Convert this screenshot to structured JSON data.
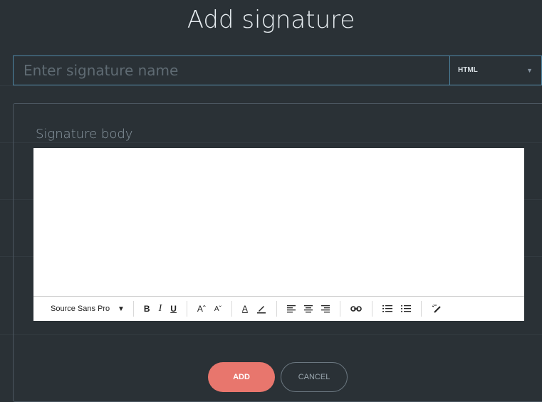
{
  "modal": {
    "title": "Add signature",
    "name_placeholder": "Enter signature name",
    "type_select": {
      "selected": "HTML"
    },
    "body_label": "Signature body"
  },
  "toolbar": {
    "font_family": "Source Sans Pro",
    "bold": "B",
    "italic": "I",
    "underline": "U",
    "font_size_up": "Aˆ",
    "font_size_down": "Aˇ",
    "text_color": "A"
  },
  "actions": {
    "add_label": "ADD",
    "cancel_label": "CANCEL"
  },
  "colors": {
    "background": "#2a3136",
    "accent": "#4f87a6",
    "add_button": "#e8766d"
  }
}
